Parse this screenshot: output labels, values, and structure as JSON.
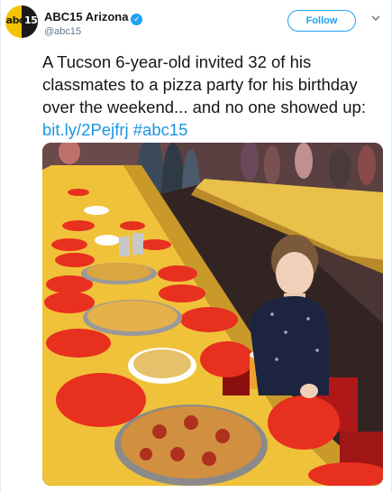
{
  "account": {
    "display_name": "ABC15 Arizona",
    "handle": "@abc15",
    "avatar_text_a": "abc",
    "avatar_text_b": "15",
    "verified": true
  },
  "actions": {
    "follow_label": "Follow"
  },
  "tweet": {
    "text": "A Tucson 6-year-old invited 32 of his classmates to a pizza party for his birthday over the weekend... and no one showed up: ",
    "link": "bit.ly/2Pejfrj",
    "hashtag": "#abc15"
  },
  "icons": {
    "verified": "verified-check-icon",
    "menu": "chevron-down-icon"
  },
  "colors": {
    "accent": "#1da1f2",
    "link": "#1b95e0",
    "avatar_yellow": "#f2c400",
    "plate_red": "#e8301f",
    "table_yellow": "#f0c23a"
  }
}
